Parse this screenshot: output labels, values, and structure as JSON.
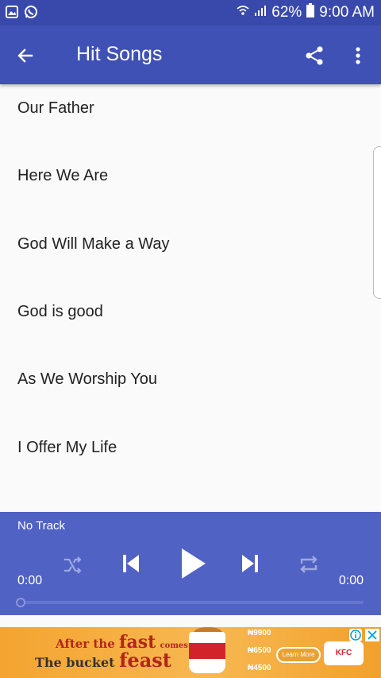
{
  "status_bar": {
    "battery": "62%",
    "time": "9:00 AM"
  },
  "toolbar": {
    "title": "Hit Songs"
  },
  "songs": [
    {
      "title": "Our Father"
    },
    {
      "title": "Here We Are"
    },
    {
      "title": "God Will Make a Way"
    },
    {
      "title": "God is good"
    },
    {
      "title": "As We Worship You"
    },
    {
      "title": "I Offer My Life"
    }
  ],
  "player": {
    "track": "No Track",
    "time_elapsed": "0:00",
    "time_total": "0:00",
    "progress": 0
  },
  "ad": {
    "line1_a": "After the",
    "line1_b": "fast",
    "line1_c": "comes",
    "line2_a": "The bucket",
    "line2_b": "feast",
    "price1": "₦9900",
    "price2": "₦6500",
    "price3": "₦4500",
    "button": "Learn More",
    "brand": "KFC"
  },
  "colors": {
    "status_bar": "#3949ab",
    "toolbar": "#3f51b5",
    "player": "#5062c4"
  }
}
